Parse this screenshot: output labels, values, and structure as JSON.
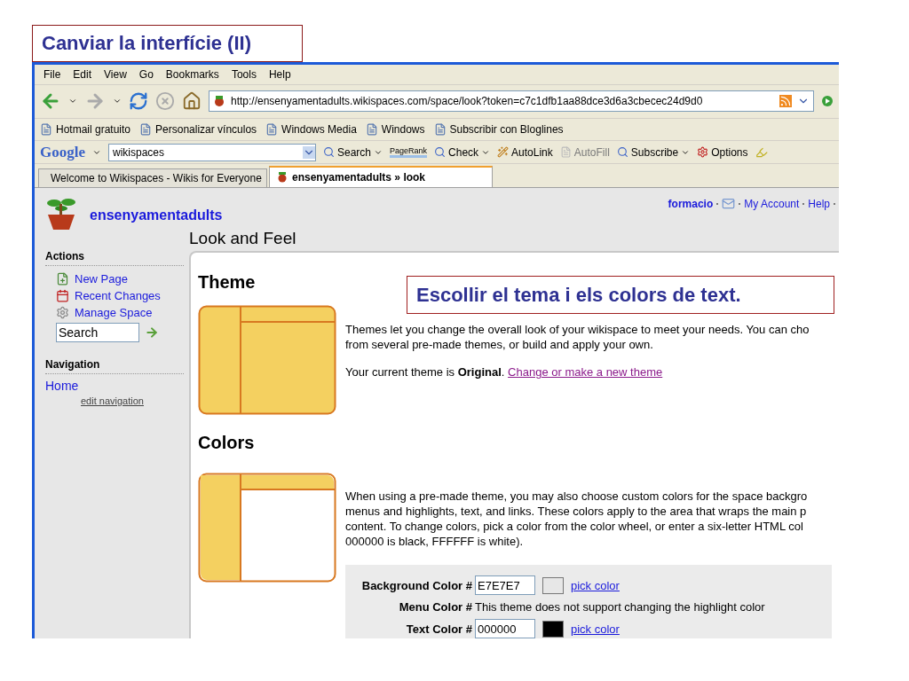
{
  "slide_title": "Canviar la interfície (II)",
  "callout": "Escollir el tema i els colors de text.",
  "browser": {
    "menu": [
      "File",
      "Edit",
      "View",
      "Go",
      "Bookmarks",
      "Tools",
      "Help"
    ],
    "address": "http://ensenyamentadults.wikispaces.com/space/look?token=c7c1dfb1aa88dce3d6a3cbecec24d9d0",
    "bookmarks": [
      "Hotmail gratuito",
      "Personalizar vínculos",
      "Windows Media",
      "Windows",
      "Subscribir con Bloglines"
    ],
    "google_toolbar": {
      "logo": "Google",
      "query": "wikispaces",
      "items": [
        {
          "kind": "dropdown",
          "label": "Search",
          "disabled": false
        },
        {
          "kind": "pagerank",
          "label": "PageRank",
          "disabled": false
        },
        {
          "kind": "dropdown",
          "label": "Check",
          "disabled": false
        },
        {
          "kind": "button",
          "label": "AutoLink",
          "disabled": false
        },
        {
          "kind": "button",
          "label": "AutoFill",
          "disabled": true
        },
        {
          "kind": "dropdown",
          "label": "Subscribe",
          "disabled": false
        },
        {
          "kind": "button",
          "label": "Options",
          "disabled": false
        }
      ]
    },
    "tabs": [
      {
        "label": "Welcome to Wikispaces - Wikis for Everyone",
        "selected": false
      },
      {
        "label": "ensenyamentadults » look",
        "selected": true
      }
    ]
  },
  "page": {
    "space_name": "ensenyamentadults",
    "user": "formacio",
    "user_links": [
      "My Account",
      "Help"
    ],
    "heading": "Look and Feel",
    "sidebar": {
      "actions_title": "Actions",
      "actions": [
        {
          "kind": "new",
          "label": "New Page"
        },
        {
          "kind": "calendar",
          "label": "Recent Changes"
        },
        {
          "kind": "gear",
          "label": "Manage Space"
        }
      ],
      "search_placeholder": "Search",
      "navigation_title": "Navigation",
      "nav_items": [
        "Home"
      ],
      "edit_navigation": "edit navigation"
    },
    "theme": {
      "title": "Theme",
      "description": [
        "Themes let you change the overall look of your wikispace to meet your needs. You can cho",
        "from several pre-made themes, or build and apply your own."
      ],
      "current": "Your current theme is **Original**.",
      "link": "Change or make a new theme"
    },
    "colors": {
      "title": "Colors",
      "description": [
        "When using a pre-made theme, you may also choose custom colors for the space backgro",
        "menus and highlights, text, and links. These colors apply to the area that wraps the main p",
        "content. To change colors, pick a color from the color wheel, or enter a six-letter HTML col",
        "000000 is black, FFFFFF is white)."
      ],
      "fields": [
        {
          "kind": "input",
          "label": "Background Color #",
          "value": "E7E7E7",
          "link": "pick color"
        },
        {
          "kind": "note",
          "label": "Menu Color #",
          "note": "This theme does not support changing the highlight color"
        },
        {
          "kind": "input",
          "label": "Text Color #",
          "value": "000000",
          "link": "pick color"
        }
      ]
    }
  }
}
